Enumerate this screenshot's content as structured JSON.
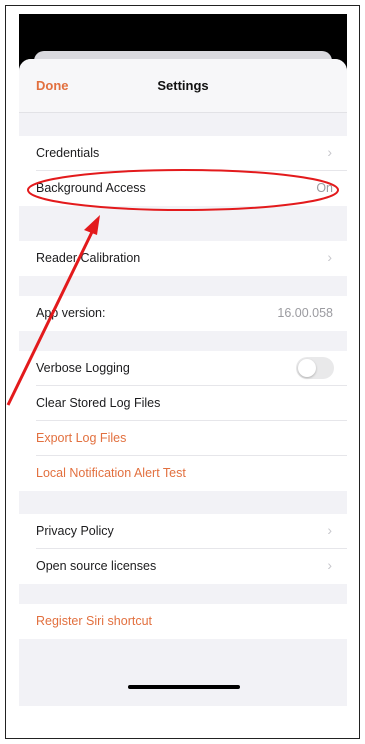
{
  "navbar": {
    "done_label": "Done",
    "title": "Settings"
  },
  "sections": {
    "credentials": {
      "label": "Credentials"
    },
    "background_access": {
      "label": "Background Access",
      "value": "On"
    },
    "reader_calibration": {
      "label": "Reader Calibration"
    },
    "app_version": {
      "label": "App version:",
      "value": "16.00.058"
    },
    "verbose_logging": {
      "label": "Verbose Logging",
      "enabled": false
    },
    "clear_logs": {
      "label": "Clear Stored Log Files"
    },
    "export_logs": {
      "label": "Export Log Files"
    },
    "local_notification_test": {
      "label": "Local Notification Alert Test"
    },
    "privacy_policy": {
      "label": "Privacy Policy"
    },
    "open_source": {
      "label": "Open source licenses"
    },
    "siri_shortcut": {
      "label": "Register Siri shortcut"
    }
  },
  "icons": {
    "chevron": "chevron-right-icon"
  },
  "colors": {
    "accent": "#e2703f",
    "annotation": "#e31a1c"
  }
}
